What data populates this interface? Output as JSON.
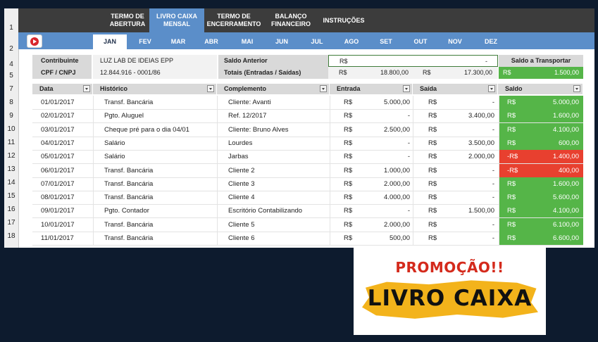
{
  "nav": {
    "items": [
      "TERMO DE\nABERTURA",
      "LIVRO CAIXA\nMENSAL",
      "TERMO DE\nENCERRAMENTO",
      "BALANÇO\nFINANCEIRO",
      "INSTRUÇÕES"
    ],
    "active": "LIVRO CAIXA MENSAL"
  },
  "months": [
    "JAN",
    "FEV",
    "MAR",
    "ABR",
    "MAI",
    "JUN",
    "JUL",
    "AGO",
    "SET",
    "OUT",
    "NOV",
    "DEZ"
  ],
  "row_numbers": [
    "1",
    "2",
    "4",
    "5",
    "7",
    "8",
    "9",
    "10",
    "11",
    "12",
    "13",
    "14",
    "15",
    "16",
    "17",
    "18"
  ],
  "info": {
    "contribuinte_label": "Contribuinte",
    "contribuinte_value": "LUZ LAB DE IDEIAS EPP",
    "cpf_label": "CPF / CNPJ",
    "cpf_value": "12.844.916 - 0001/86",
    "saldo_anterior_label": "Saldo Anterior",
    "saldo_anterior_currency": "R$",
    "saldo_anterior_value": "-",
    "totais_label": "Totais (Entradas / Saídas)",
    "totais_currency_1": "R$",
    "totais_entradas": "18.800,00",
    "totais_currency_2": "R$",
    "totais_saidas": "17.300,00",
    "saldo_transportar_label": "Saldo a Transportar",
    "saldo_transportar_currency": "R$",
    "saldo_transportar_value": "1.500,00"
  },
  "table": {
    "headers": [
      "Data",
      "Histórico",
      "Complemento",
      "Entrada",
      "Saída",
      "Saldo"
    ],
    "currency": "R$",
    "rows": [
      {
        "data": "01/01/2017",
        "historico": "Transf. Bancária",
        "complemento": "Cliente: Avanti",
        "entrada": "5.000,00",
        "saida": "-",
        "saldo_prefix": "R$",
        "saldo": "5.000,00",
        "status": "positive"
      },
      {
        "data": "02/01/2017",
        "historico": "Pgto. Aluguel",
        "complemento": "Ref. 12/2017",
        "entrada": "-",
        "saida": "3.400,00",
        "saldo_prefix": "R$",
        "saldo": "1.600,00",
        "status": "positive"
      },
      {
        "data": "03/01/2017",
        "historico": "Cheque pré para o dia 04/01",
        "complemento": "Cliente: Bruno Alves",
        "entrada": "2.500,00",
        "saida": "-",
        "saldo_prefix": "R$",
        "saldo": "4.100,00",
        "status": "positive"
      },
      {
        "data": "04/01/2017",
        "historico": "Salário",
        "complemento": "Lourdes",
        "entrada": "-",
        "saida": "3.500,00",
        "saldo_prefix": "R$",
        "saldo": "600,00",
        "status": "positive"
      },
      {
        "data": "05/01/2017",
        "historico": "Salário",
        "complemento": "Jarbas",
        "entrada": "-",
        "saida": "2.000,00",
        "saldo_prefix": "-R$",
        "saldo": "1.400,00",
        "status": "negative"
      },
      {
        "data": "06/01/2017",
        "historico": "Transf. Bancária",
        "complemento": "Cliente 2",
        "entrada": "1.000,00",
        "saida": "-",
        "saldo_prefix": "-R$",
        "saldo": "400,00",
        "status": "negative"
      },
      {
        "data": "07/01/2017",
        "historico": "Transf. Bancária",
        "complemento": "Cliente 3",
        "entrada": "2.000,00",
        "saida": "-",
        "saldo_prefix": "R$",
        "saldo": "1.600,00",
        "status": "positive"
      },
      {
        "data": "08/01/2017",
        "historico": "Transf. Bancária",
        "complemento": "Cliente 4",
        "entrada": "4.000,00",
        "saida": "-",
        "saldo_prefix": "R$",
        "saldo": "5.600,00",
        "status": "positive"
      },
      {
        "data": "09/01/2017",
        "historico": "Pgto. Contador",
        "complemento": "Escritório Contabilizando",
        "entrada": "-",
        "saida": "1.500,00",
        "saldo_prefix": "R$",
        "saldo": "4.100,00",
        "status": "positive"
      },
      {
        "data": "10/01/2017",
        "historico": "Transf. Bancária",
        "complemento": "Cliente 5",
        "entrada": "2.000,00",
        "saida": "-",
        "saldo_prefix": "R$",
        "saldo": "6.100,00",
        "status": "positive"
      },
      {
        "data": "11/01/2017",
        "historico": "Transf. Bancária",
        "complemento": "Cliente 6",
        "entrada": "500,00",
        "saida": "-",
        "saldo_prefix": "R$",
        "saldo": "6.600,00",
        "status": "positive"
      }
    ]
  },
  "colors": {
    "positive": "#55b548",
    "negative": "#e8402f",
    "accent": "#5b8ec9",
    "nav": "#3c3c3c"
  },
  "icons": {
    "video": "youtube-play-icon",
    "filter": "dropdown-filter-icon"
  },
  "promo": {
    "top": "PROMOÇÃO!!",
    "main": "LIVRO CAIXA"
  }
}
